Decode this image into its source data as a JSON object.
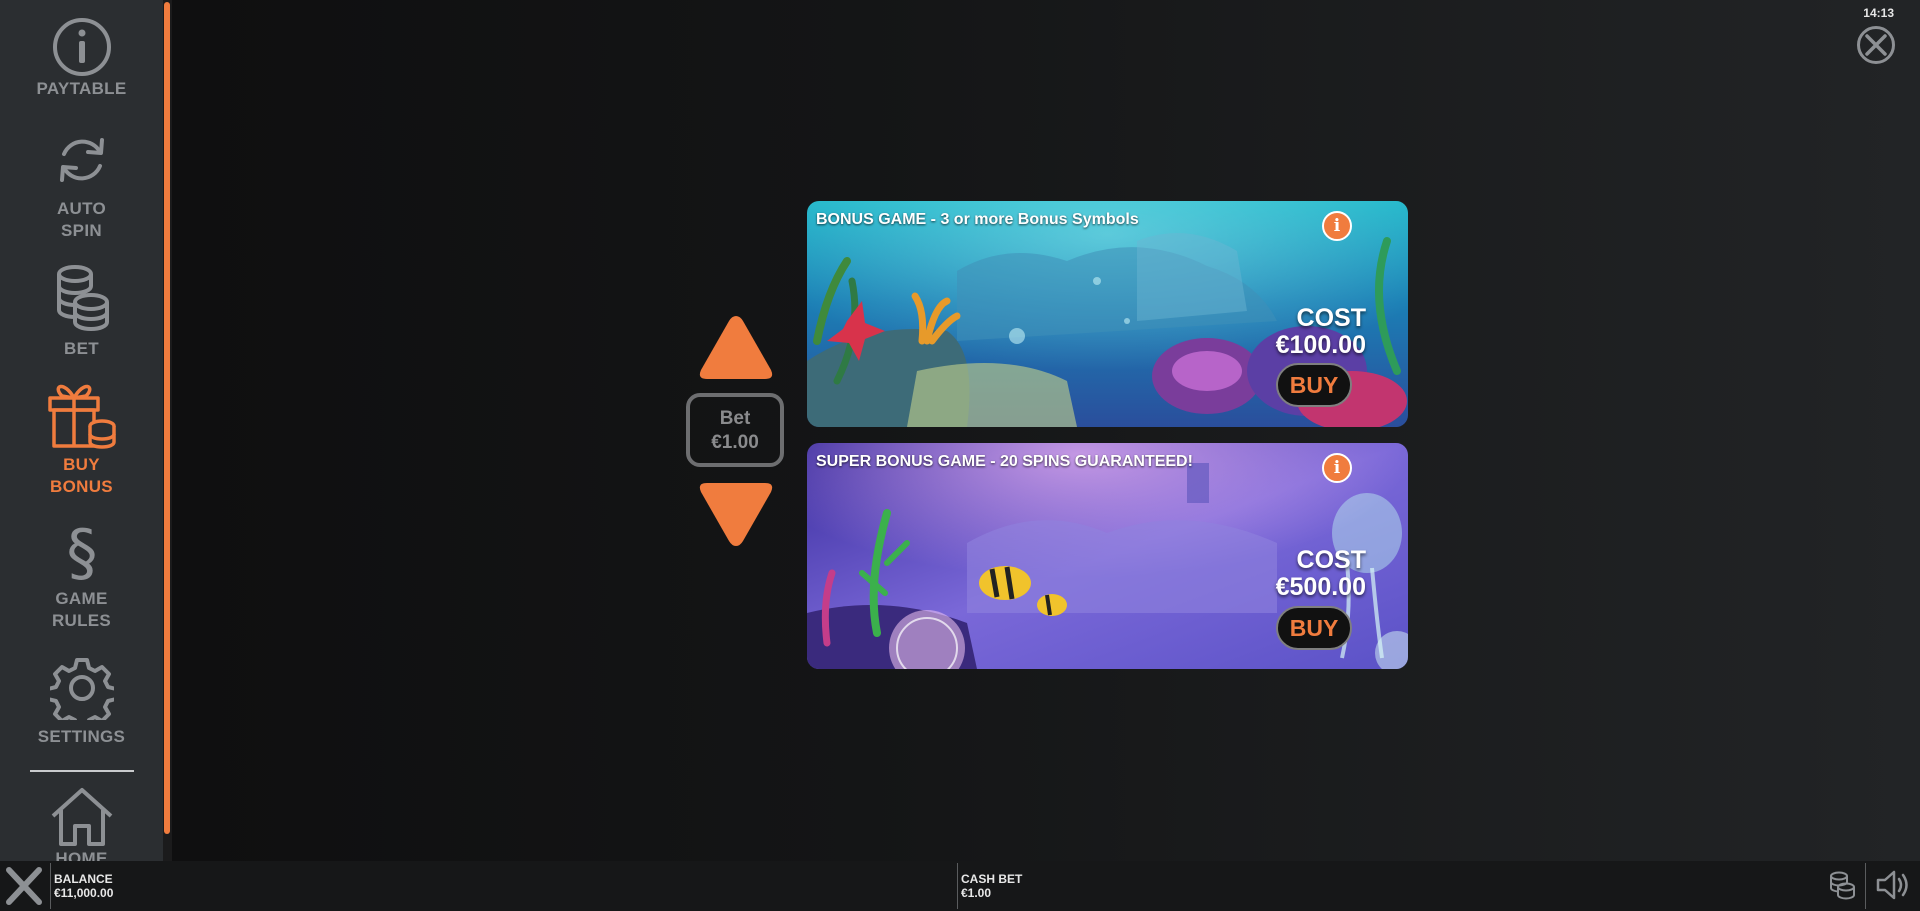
{
  "clock": "14:13",
  "sidebar": {
    "items": [
      {
        "label": "PAYTABLE",
        "icon": "info-icon"
      },
      {
        "label": "AUTO\nSPIN",
        "icon": "refresh-icon"
      },
      {
        "label": "BET",
        "icon": "coins-icon"
      },
      {
        "label": "BUY\nBONUS",
        "icon": "gift-coins-icon",
        "active": true
      },
      {
        "label": "GAME\nRULES",
        "icon": "section-icon"
      },
      {
        "label": "SETTINGS",
        "icon": "gear-icon"
      },
      {
        "label": "HOME",
        "icon": "home-icon"
      }
    ]
  },
  "bet": {
    "label": "Bet",
    "value": "€1.00"
  },
  "cards": [
    {
      "title": "BONUS GAME - 3 or more Bonus Symbols",
      "cost_label": "COST",
      "cost_value": "€100.00",
      "buy_label": "BUY"
    },
    {
      "title": "SUPER BONUS GAME - 20 SPINS GUARANTEED!",
      "cost_label": "COST",
      "cost_value": "€500.00",
      "buy_label": "BUY"
    }
  ],
  "bottom": {
    "balance_label": "BALANCE",
    "balance_value": "€11,000.00",
    "cashbet_label": "CASH BET",
    "cashbet_value": "€1.00"
  },
  "colors": {
    "accent": "#f07c3e",
    "sidebar": "#2b2e31",
    "icon_gray": "#8d9094"
  }
}
